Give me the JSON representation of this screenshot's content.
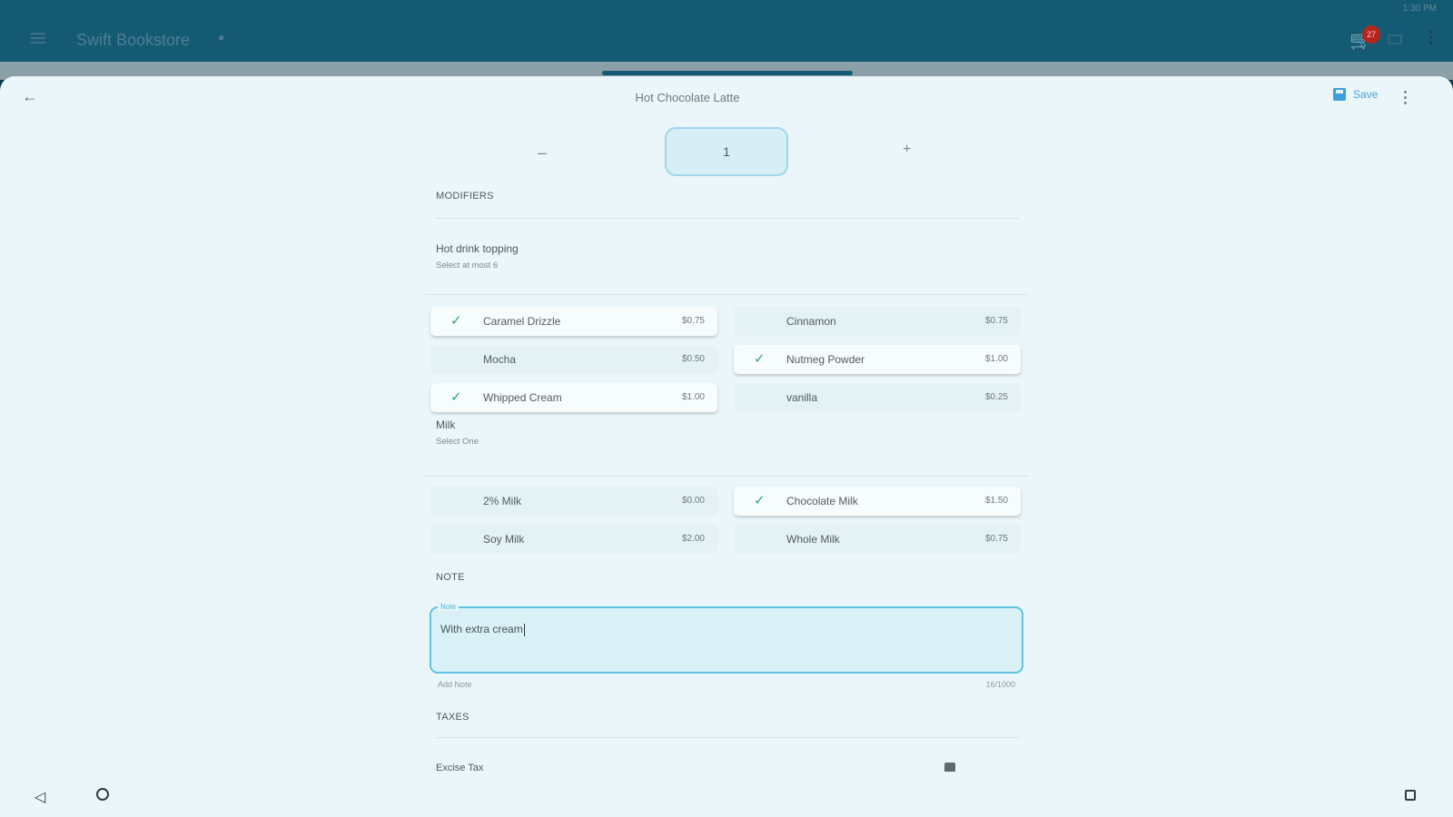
{
  "status": {
    "time": "1:30 PM"
  },
  "appbar": {
    "title": "Swift Bookstore",
    "cart_count": "27",
    "icons": [
      "menu-icon",
      "pin-icon",
      "cart-icon",
      "chat-icon",
      "more-vert-icon"
    ]
  },
  "sheet": {
    "title": "Hot Chocolate Latte",
    "save_label": "Save",
    "back_icon": "arrow-back-icon",
    "save_icon": "save-icon"
  },
  "quantity": {
    "minus": "–",
    "value": "1",
    "plus": "+"
  },
  "modifiers": {
    "heading": "MODIFIERS",
    "groups": [
      {
        "title": "Hot drink topping",
        "subtitle": "Select at most 6",
        "options": [
          {
            "name": "Caramel Drizzle",
            "price": "$0.75",
            "selected": true
          },
          {
            "name": "Cinnamon",
            "price": "$0.75",
            "selected": false
          },
          {
            "name": "Mocha",
            "price": "$0.50",
            "selected": false
          },
          {
            "name": "Nutmeg Powder",
            "price": "$1.00",
            "selected": true
          },
          {
            "name": "Whipped Cream",
            "price": "$1.00",
            "selected": true
          },
          {
            "name": "vanilla",
            "price": "$0.25",
            "selected": false
          }
        ]
      },
      {
        "title": "Milk",
        "subtitle": "Select One",
        "options": [
          {
            "name": "2% Milk",
            "price": "$0.00",
            "selected": false
          },
          {
            "name": "Chocolate Milk",
            "price": "$1.50",
            "selected": true
          },
          {
            "name": "Soy Milk",
            "price": "$2.00",
            "selected": false
          },
          {
            "name": "Whole Milk",
            "price": "$0.75",
            "selected": false
          }
        ]
      }
    ]
  },
  "note": {
    "heading": "NOTE",
    "label": "Note",
    "value": "With extra cream",
    "helper": "Add Note",
    "counter": "16/1000"
  },
  "taxes": {
    "heading": "TAXES",
    "first_item": "Excise Tax"
  },
  "colors": {
    "primary": "#155a73",
    "accent": "#3b9fe0",
    "check": "#2fa67a"
  }
}
